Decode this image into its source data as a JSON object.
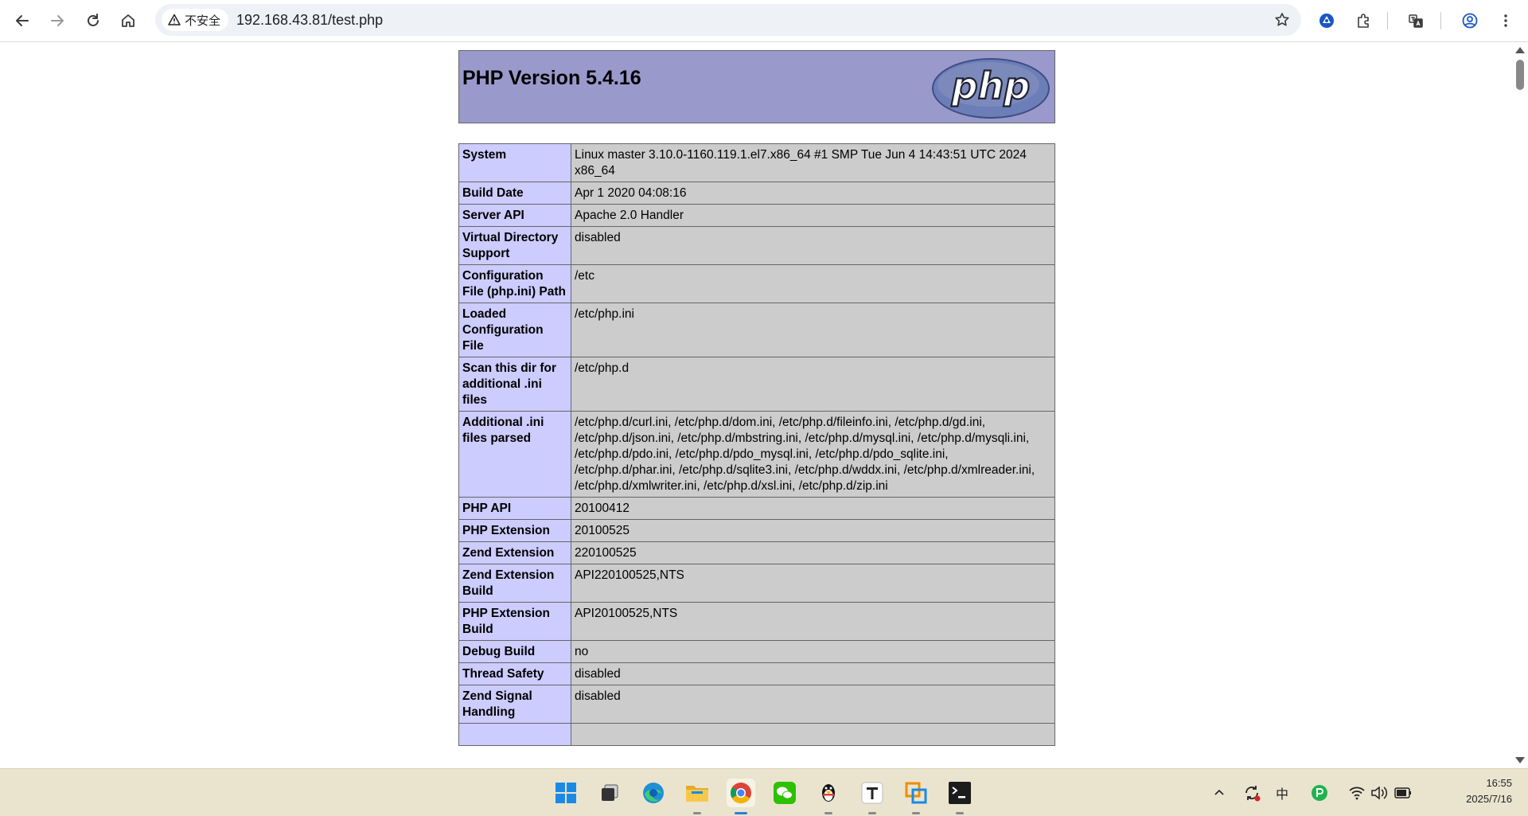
{
  "browser": {
    "security_label": "不安全",
    "url": "192.168.43.81/test.php"
  },
  "php": {
    "title": "PHP Version 5.4.16",
    "logo_text": "php",
    "rows": [
      {
        "name": "System",
        "value": "Linux master 3.10.0-1160.119.1.el7.x86_64 #1 SMP Tue Jun 4 14:43:51 UTC 2024 x86_64"
      },
      {
        "name": "Build Date",
        "value": "Apr 1 2020 04:08:16"
      },
      {
        "name": "Server API",
        "value": "Apache 2.0 Handler"
      },
      {
        "name": "Virtual Directory Support",
        "value": "disabled"
      },
      {
        "name": "Configuration File (php.ini) Path",
        "value": "/etc"
      },
      {
        "name": "Loaded Configuration File",
        "value": "/etc/php.ini"
      },
      {
        "name": "Scan this dir for additional .ini files",
        "value": "/etc/php.d"
      },
      {
        "name": "Additional .ini files parsed",
        "value": "/etc/php.d/curl.ini, /etc/php.d/dom.ini, /etc/php.d/fileinfo.ini, /etc/php.d/gd.ini, /etc/php.d/json.ini, /etc/php.d/mbstring.ini, /etc/php.d/mysql.ini, /etc/php.d/mysqli.ini, /etc/php.d/pdo.ini, /etc/php.d/pdo_mysql.ini, /etc/php.d/pdo_sqlite.ini, /etc/php.d/phar.ini, /etc/php.d/sqlite3.ini, /etc/php.d/wddx.ini, /etc/php.d/xmlreader.ini, /etc/php.d/xmlwriter.ini, /etc/php.d/xsl.ini, /etc/php.d/zip.ini"
      },
      {
        "name": "PHP API",
        "value": "20100412"
      },
      {
        "name": "PHP Extension",
        "value": "20100525"
      },
      {
        "name": "Zend Extension",
        "value": "220100525"
      },
      {
        "name": "Zend Extension Build",
        "value": "API220100525,NTS"
      },
      {
        "name": "PHP Extension Build",
        "value": "API20100525,NTS"
      },
      {
        "name": "Debug Build",
        "value": "no"
      },
      {
        "name": "Thread Safety",
        "value": "disabled"
      },
      {
        "name": "Zend Signal Handling",
        "value": "disabled"
      },
      {
        "name": "",
        "value": ""
      }
    ]
  },
  "taskbar": {
    "ime_label": "中",
    "time": "16:55",
    "date": "2025/7/16",
    "apps": [
      {
        "name": "start-button",
        "icon": "windows-logo-icon"
      },
      {
        "name": "taskbar-app-taskview",
        "icon": "task-view-icon"
      },
      {
        "name": "taskbar-app-edge",
        "icon": "edge-icon"
      },
      {
        "name": "taskbar-app-explorer",
        "icon": "folder-icon"
      },
      {
        "name": "taskbar-app-chrome",
        "icon": "chrome-icon"
      },
      {
        "name": "taskbar-app-wechat",
        "icon": "wechat-icon"
      },
      {
        "name": "taskbar-app-qq",
        "icon": "qq-penguin-icon"
      },
      {
        "name": "taskbar-app-typora",
        "icon": "typora-icon"
      },
      {
        "name": "taskbar-app-vmware",
        "icon": "vmware-icon"
      },
      {
        "name": "taskbar-app-terminal",
        "icon": "terminal-icon"
      }
    ]
  },
  "colors": {
    "php_header": "#9999cc",
    "php_key_cell": "#ccccff",
    "php_value_cell": "#cccccc",
    "taskbar_bg": "#eae4cf"
  }
}
